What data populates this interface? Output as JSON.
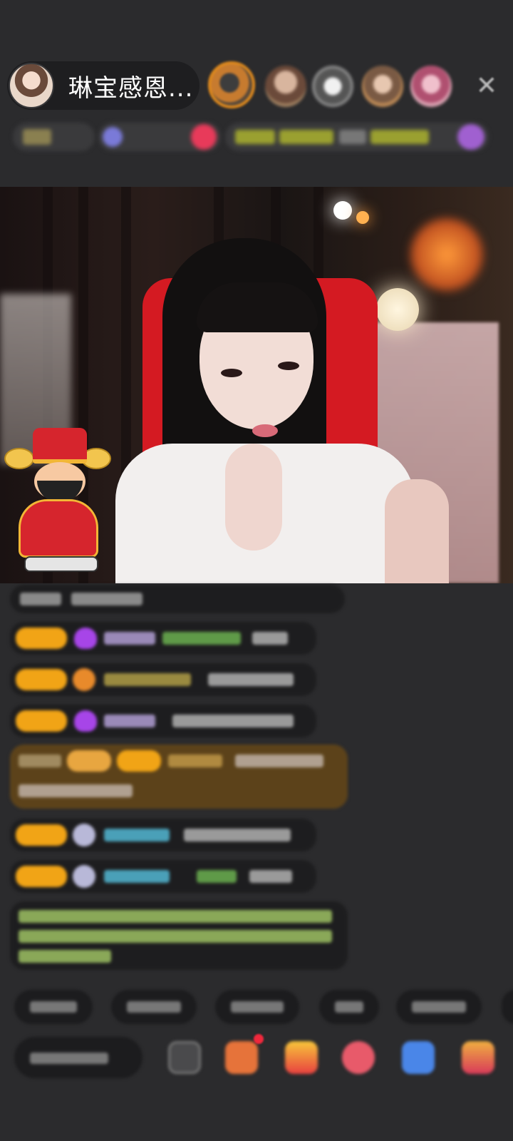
{
  "header": {
    "host_name": "琳宝感恩..."
  },
  "icons": {
    "close": "close-icon",
    "emoji": "emoji-icon",
    "gifts": [
      "gift-icon",
      "gift-box-icon",
      "lucky-bag-icon",
      "game-icon",
      "more-gifts-icon"
    ]
  },
  "colors": {
    "background": "#2b2b2d",
    "level_badge": "#f1a416",
    "highlight_message": "#6e4b14",
    "chair": "#d41a22"
  }
}
